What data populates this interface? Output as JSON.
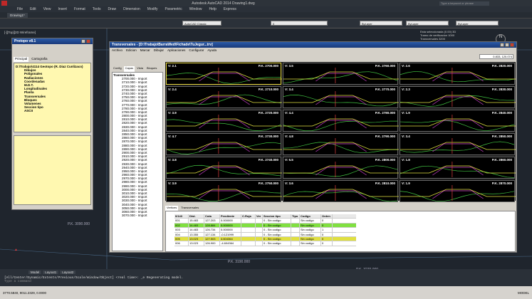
{
  "app": {
    "title": "Autodesk AutoCAD 2014   Drawing1.dwg",
    "search_placeholder": "Type a keyword or phrase"
  },
  "menu": [
    "File",
    "Edit",
    "View",
    "Insert",
    "Format",
    "Tools",
    "Draw",
    "Dimension",
    "Modify",
    "Parametric",
    "Window",
    "Help",
    "Express"
  ],
  "tab_drawing": "Drawing1*",
  "workspace": "AutoCAD Classic",
  "layer_dropdown": "0",
  "bylayer": [
    "ByLayer",
    "ByLayer",
    "ByLayer"
  ],
  "viewport_label": "[-][Top][2D Wireframe]",
  "compass": "N",
  "info_lines": [
    "Esta seleccionada (0.00) 3D",
    "Tramo de verificacion 1000",
    "Transversales 3200"
  ],
  "protopo": {
    "title": "Protopo v8.1",
    "tabs": [
      "Principal",
      "Cartografia"
    ],
    "tree": [
      "D:\\Trabajo\\4114 Geotopo (R. Diaz Cunlizaco)",
      "Dibujos",
      "Poligonales",
      "Radiaciones",
      "Coordenadas",
      "M.D.T.",
      "Longitudinales",
      "Planta",
      "Transversales",
      "Bloques",
      "Volumenes",
      "Seccion tipo",
      "ASCII"
    ]
  },
  "trans": {
    "title": "Transversales - [D:\\Trabajo\\BarraWed\\Fichade\\TuJegur...trv]",
    "menu": [
      "Archivo",
      "Edicion",
      "Marcar",
      "Dibujar",
      "Aplicaciones",
      "Configurar",
      "Ayuda"
    ],
    "coords": "0.833, 120.074",
    "left_tabs": [
      "Config",
      "Capas",
      "Vista",
      "Bloques"
    ],
    "root": "Transversales",
    "rows": [
      "2700.000 - Import",
      "2710.000 - Import",
      "2720.000 - Import",
      "2730.000 - Import",
      "2740.000 - Import",
      "2750.000 - Import",
      "2760.000 - Import",
      "2770.000 - Import",
      "2780.000 - Import",
      "2790.000 - Import",
      "2800.000 - Import",
      "2810.000 - Import",
      "2820.000 - Import",
      "2830.000 - Import",
      "2840.000 - Import",
      "2850.000 - Import",
      "2860.000 - Import",
      "2870.000 - Import",
      "2880.000 - Import",
      "2890.000 - Import",
      "2900.000 - Import",
      "2910.000 - Import",
      "2920.000 - Import",
      "2930.000 - Import",
      "2940.000 - Import",
      "2950.000 - Import",
      "2960.000 - Import",
      "2970.000 - Import",
      "2980.000 - Import",
      "2990.000 - Import",
      "3000.000 - Import",
      "3010.000 - Import",
      "3020.000 - Import",
      "3030.000 - Import",
      "3040.000 - Import",
      "3050.000 - Import",
      "3060.000 - Import",
      "3070.000 - Import"
    ],
    "panels": [
      {
        "v": "V: 2.1",
        "pk": "P.K. 2700.000"
      },
      {
        "v": "V: 3.5",
        "pk": "P.K. 2760.000"
      },
      {
        "v": "V: 2.6",
        "pk": "P.K. 2820.000"
      },
      {
        "v": "V: 2.4",
        "pk": "P.K. 2710.000"
      },
      {
        "v": "V: 3.4",
        "pk": "P.K. 2770.000"
      },
      {
        "v": "V: 2.3",
        "pk": "P.K. 2830.000"
      },
      {
        "v": "V: 3.9",
        "pk": "P.K. 2720.000"
      },
      {
        "v": "V: 4.4",
        "pk": "P.K. 2780.000"
      },
      {
        "v": "V: 1.9",
        "pk": "P.K. 2840.000"
      },
      {
        "v": "V: 4.7",
        "pk": "P.K. 2730.000"
      },
      {
        "v": "V: 4.8",
        "pk": "P.K. 2790.000"
      },
      {
        "v": "V: 3.4",
        "pk": "P.K. 2850.000"
      },
      {
        "v": "V: 3.8",
        "pk": "P.K. 2740.000"
      },
      {
        "v": "V: 5.5",
        "pk": "P.K. 2800.000"
      },
      {
        "v": "V: 1.8",
        "pk": "P.K. 2860.000"
      },
      {
        "v": "V: 3.9",
        "pk": "P.K. 2750.000"
      },
      {
        "v": "V: 3.6",
        "pk": "P.K. 2810.000"
      },
      {
        "v": "V: 1.9",
        "pk": "P.K. 2870.000"
      }
    ],
    "grid_tabs": [
      "Vertices",
      "Transversales"
    ],
    "grid_head": [
      "0/143",
      "Dist.",
      "Cota",
      "Pendiente",
      "C.Roja",
      "Ver",
      "Seccion tipo",
      "Tipo",
      "Codigo",
      "Orden"
    ],
    "grid_rows": [
      [
        "001",
        "15.483",
        "127.203",
        "0.000000",
        "",
        "",
        "0 - Sin codigo",
        "",
        "Sin codigo",
        "0"
      ],
      [
        "002",
        "14.483",
        "128.884",
        "0.000000",
        "",
        "",
        "0 - Sin codigo",
        "",
        "Sin codigo",
        "0"
      ],
      [
        "003",
        "14.483",
        "126.734",
        "0.000000",
        "",
        "",
        "0 - Sin codigo",
        "",
        "Sin codigo",
        "1"
      ],
      [
        "004",
        "13.355",
        "127.134",
        "-0.121999",
        "",
        "",
        "0 - Sin codigo",
        "",
        "Sin codigo",
        "0"
      ],
      [
        "005",
        "13.023",
        "127.503",
        "4.604364",
        "",
        "",
        "0 - Sin codigo",
        "",
        "Sin codigo",
        "0"
      ],
      [
        "006",
        "13.023",
        "126.900",
        "-4.604364",
        "",
        "",
        "0 - Sin codigo",
        "",
        "Sin codigo",
        "0"
      ]
    ]
  },
  "pk_labels": [
    "P.K. 3090.000",
    "P.K. 3190.000",
    "P.K. 3270.000",
    "P.K. 3090.000"
  ],
  "layout_tabs": [
    "Model",
    "Layout1",
    "Layout2"
  ],
  "command_lines": [
    "[All/Center/Dynamic/Extents/Previous/Scale/Window/Object] <real time>: _e Regenerating model.",
    "Type a command"
  ],
  "status": {
    "coords": "3770.5840, 9011.2329, 0.0000",
    "right": "MODEL"
  }
}
